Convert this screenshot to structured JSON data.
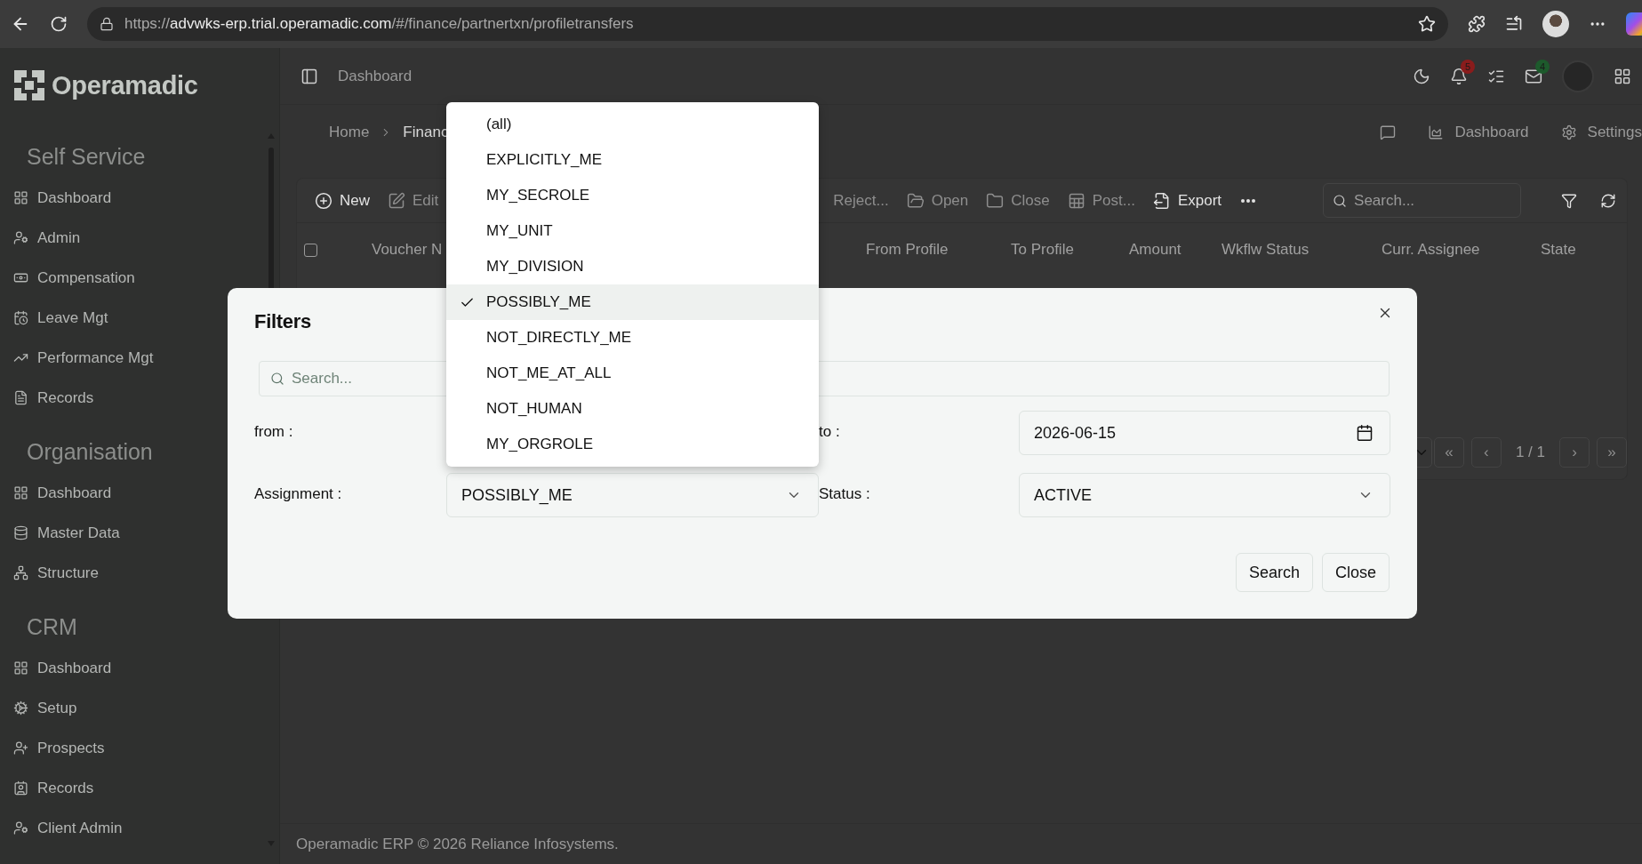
{
  "browser": {
    "url_scheme": "https://",
    "url_host": "advwks-erp.trial.operamadic.com",
    "url_path": "/#/finance/partnertxn/profiletransfers"
  },
  "app": {
    "logo": "Operamadic",
    "page_title": "Dashboard",
    "notification_count": "5",
    "mail_count": "4"
  },
  "sidebar": {
    "sections": [
      {
        "title": "Self Service",
        "items": [
          "Dashboard",
          "Admin",
          "Compensation",
          "Leave Mgt",
          "Performance Mgt",
          "Records"
        ]
      },
      {
        "title": "Organisation",
        "items": [
          "Dashboard",
          "Master Data",
          "Structure"
        ]
      },
      {
        "title": "CRM",
        "items": [
          "Dashboard",
          "Setup",
          "Prospects",
          "Records",
          "Client Admin"
        ]
      }
    ]
  },
  "breadcrumb": [
    "Home",
    "Financ"
  ],
  "header_links": [
    "Dashboard",
    "Settings"
  ],
  "toolbar": {
    "actions": [
      {
        "label": "New",
        "disabled": false
      },
      {
        "label": "Edit",
        "disabled": true
      },
      {
        "label": "Reject...",
        "disabled": true
      },
      {
        "label": "Open",
        "disabled": true
      },
      {
        "label": "Close",
        "disabled": true
      },
      {
        "label": "Post...",
        "disabled": true
      },
      {
        "label": "Export",
        "disabled": false
      }
    ],
    "search": {
      "placeholder": "Search..."
    }
  },
  "table": {
    "select_all_checked": false,
    "columns": [
      "Voucher N",
      "From Profile",
      "To Profile",
      "Amount",
      "Wkflw Status",
      "Curr. Assignee",
      "State"
    ]
  },
  "pagination": {
    "first": "«",
    "prev": "‹",
    "page": "1 / 1",
    "next": "›",
    "last": "»"
  },
  "footer": "Operamadic ERP © 2026 Reliance Infosystems.",
  "modal": {
    "title": "Filters",
    "search": {
      "placeholder": "Search..."
    },
    "fields": [
      {
        "label": "from :"
      },
      {
        "label": "to :",
        "kind": "date",
        "value": "2026-06-15"
      },
      {
        "label": "Assignment :",
        "kind": "select",
        "value": "POSSIBLY_ME"
      },
      {
        "label": "Status :",
        "kind": "select",
        "value": "ACTIVE"
      }
    ],
    "buttons": [
      "Search",
      "Close"
    ]
  },
  "dropdown": {
    "options": [
      {
        "label": "(all)",
        "selected": false
      },
      {
        "label": "EXPLICITLY_ME",
        "selected": false
      },
      {
        "label": "MY_SECROLE",
        "selected": false
      },
      {
        "label": "MY_UNIT",
        "selected": false
      },
      {
        "label": "MY_DIVISION",
        "selected": false
      },
      {
        "label": "POSSIBLY_ME",
        "selected": true
      },
      {
        "label": "NOT_DIRECTLY_ME",
        "selected": false
      },
      {
        "label": "NOT_ME_AT_ALL",
        "selected": false
      },
      {
        "label": "NOT_HUMAN",
        "selected": false
      },
      {
        "label": "MY_ORGROLE",
        "selected": false
      }
    ]
  }
}
